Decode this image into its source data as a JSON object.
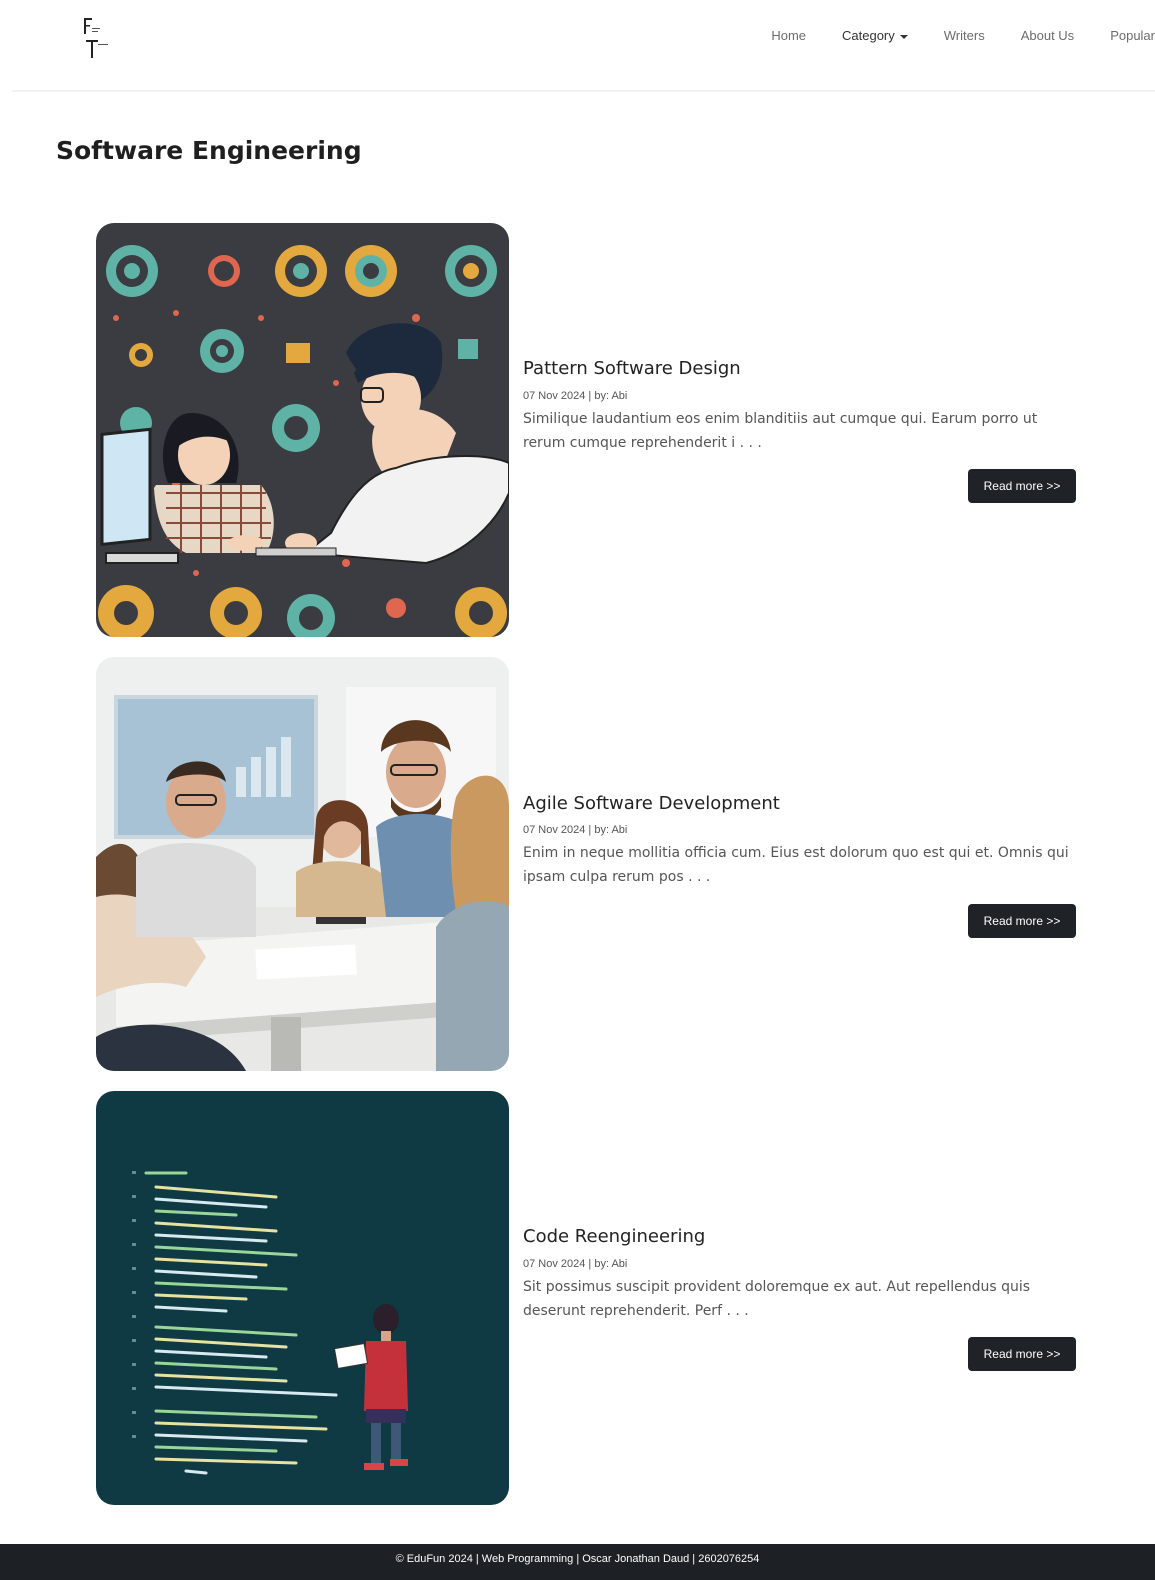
{
  "nav": {
    "items": [
      {
        "label": "Home"
      },
      {
        "label": "Category"
      },
      {
        "label": "Writers"
      },
      {
        "label": "About Us"
      },
      {
        "label": "Popular"
      }
    ]
  },
  "page": {
    "title": "Software Engineering"
  },
  "articles": [
    {
      "title": "Pattern Software Design",
      "meta": "07 Nov 2024 | by: Abi",
      "excerpt": "Similique laudantium eos enim blanditiis aut cumque qui. Earum porro ut rerum cumque reprehenderit i . . .",
      "button": "Read more >>"
    },
    {
      "title": "Agile Software Development",
      "meta": "07 Nov 2024 | by: Abi",
      "excerpt": "Enim in neque mollitia officia cum. Eius est dolorum quo est qui et. Omnis qui ipsam culpa rerum pos . . .",
      "button": "Read more >>"
    },
    {
      "title": "Code Reengineering",
      "meta": "07 Nov 2024 | by: Abi",
      "excerpt": "Sit possimus suscipit provident doloremque ex aut. Aut repellendus quis deserunt reprehenderit. Perf . . .",
      "button": "Read more >>"
    }
  ],
  "footer": {
    "text": "© EduFun 2024 | Web Programming | Oscar Jonathan Daud | 2602076254"
  },
  "colors": {
    "button_bg": "#1f2227",
    "footer_bg": "#1d2024",
    "title": "#1f1f1f"
  }
}
